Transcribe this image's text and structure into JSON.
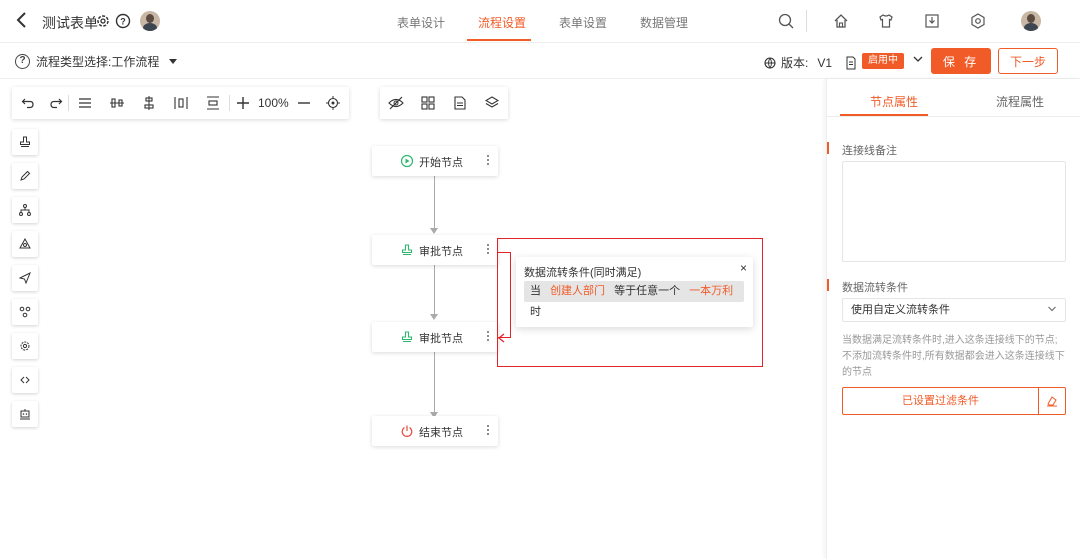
{
  "header": {
    "form_title": "测试表单",
    "tabs": [
      {
        "label": "表单设计",
        "active": false
      },
      {
        "label": "流程设置",
        "active": true
      },
      {
        "label": "表单设置",
        "active": false
      },
      {
        "label": "数据管理",
        "active": false
      }
    ],
    "accent_color": "#f05b28"
  },
  "subbar": {
    "flow_type_label": "流程类型选择:工作流程",
    "version_label": "版本:",
    "version_value": "V1",
    "status_badge": "启用中",
    "save_label": "保 存",
    "next_label": "下一步"
  },
  "toolbar": {
    "zoom": "100%"
  },
  "flow": {
    "nodes": [
      {
        "label": "开始节点",
        "icon": "play-circle-icon"
      },
      {
        "label": "审批节点",
        "icon": "stamp-icon"
      },
      {
        "label": "审批节点",
        "icon": "stamp-icon"
      },
      {
        "label": "结束节点",
        "icon": "power-icon"
      }
    ],
    "condition_popup": {
      "title": "数据流转条件(同时满足)",
      "close": "×",
      "parts": {
        "when": "当",
        "field": "创建人部门",
        "op": "等于任意一个",
        "value": "一本万利",
        "suffix": "时"
      }
    }
  },
  "right_panel": {
    "tabs": [
      {
        "label": "节点属性",
        "active": true
      },
      {
        "label": "流程属性",
        "active": false
      }
    ],
    "remark_label": "连接线备注",
    "condition_label": "数据流转条件",
    "condition_select": "使用自定义流转条件",
    "description": "当数据满足流转条件时,进入这条连接线下的节点;不添加流转条件时,所有数据都会进入这条连接线下的节点",
    "filter_button": "已设置过滤条件"
  }
}
